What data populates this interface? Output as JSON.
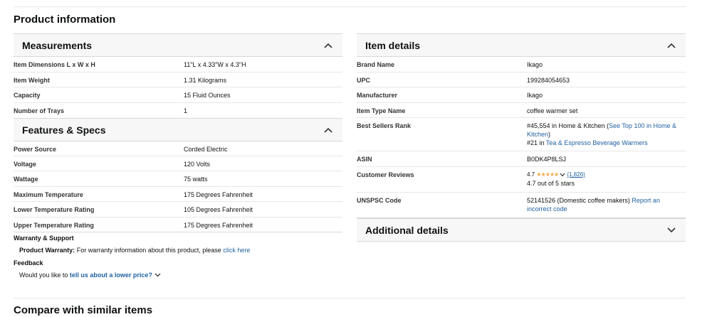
{
  "page_title": "Product information",
  "measurements": {
    "title": "Measurements",
    "rows": [
      {
        "k": "Item Dimensions L x W x H",
        "v": "11\"L x 4.33\"W x 4.3\"H"
      },
      {
        "k": "Item Weight",
        "v": "1.31 Kilograms"
      },
      {
        "k": "Capacity",
        "v": "15 Fluid Ounces"
      },
      {
        "k": "Number of Trays",
        "v": "1"
      }
    ]
  },
  "features": {
    "title": "Features & Specs",
    "rows": [
      {
        "k": "Power Source",
        "v": "Corded Electric"
      },
      {
        "k": "Voltage",
        "v": "120 Volts"
      },
      {
        "k": "Wattage",
        "v": "75 watts"
      },
      {
        "k": "Maximum Temperature",
        "v": "175 Degrees Fahrenheit"
      },
      {
        "k": "Lower Temperature Rating",
        "v": "105 Degrees Fahrenheit"
      },
      {
        "k": "Upper Temperature Rating",
        "v": "175 Degrees Fahrenheit"
      }
    ]
  },
  "warranty": {
    "title": "Warranty & Support",
    "label": "Product Warranty:",
    "text": "For warranty information about this product, please",
    "link": "click here"
  },
  "feedback": {
    "title": "Feedback",
    "text": "Would you like to",
    "link": "tell us about a lower price?"
  },
  "item_details": {
    "title": "Item details",
    "brand": {
      "k": "Brand Name",
      "v": "Ikago"
    },
    "upc": {
      "k": "UPC",
      "v": "199284054653"
    },
    "manufacturer": {
      "k": "Manufacturer",
      "v": "Ikago"
    },
    "type": {
      "k": "Item Type Name",
      "v": "coffee warmer set"
    },
    "bsr": {
      "k": "Best Sellers Rank",
      "rank1": "#45,554 in Home & Kitchen (",
      "rank1_link": "See Top 100 in Home & Kitchen",
      "rank1_end": ")",
      "rank2": "#21 in ",
      "rank2_link": "Tea & Espresso Beverage Warmers"
    },
    "asin": {
      "k": "ASIN",
      "v": "B0DK4P8LSJ"
    },
    "reviews": {
      "k": "Customer Reviews",
      "rating": "4.7",
      "stars": "★★★★★",
      "count": "(1,826)",
      "summary": "4.7 out of 5 stars"
    },
    "unspsc": {
      "k": "UNSPSC Code",
      "v": "52141526 (Domestic coffee makers)",
      "link": "Report an incorrect code"
    }
  },
  "additional": {
    "title": "Additional details"
  },
  "next_section": "Compare with similar items"
}
